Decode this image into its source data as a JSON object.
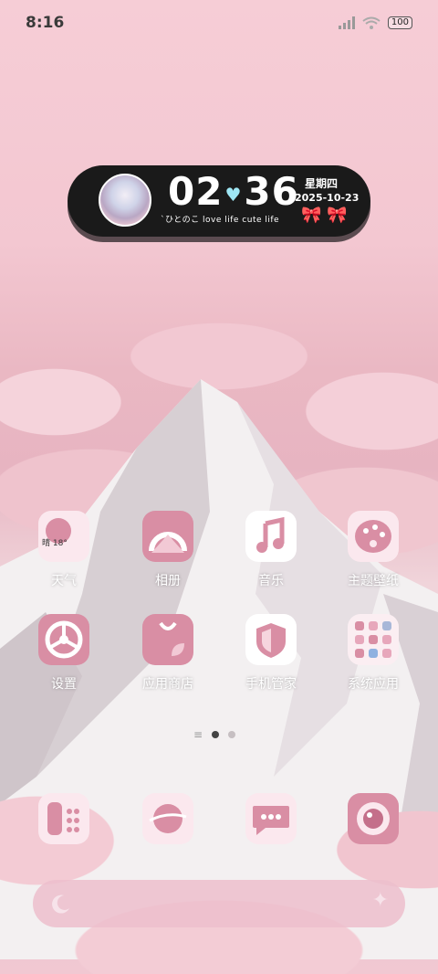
{
  "status": {
    "time": "8:16",
    "battery": "100"
  },
  "widget": {
    "hours": "02",
    "minutes": "36",
    "weekday": "星期四",
    "date": "2025-10-23",
    "tagline": "`ひとのこ love life cute life"
  },
  "apps": [
    {
      "name": "weather",
      "label": "天气",
      "sub": "晴 18°"
    },
    {
      "name": "gallery",
      "label": "相册"
    },
    {
      "name": "music",
      "label": "音乐"
    },
    {
      "name": "themes",
      "label": "主题壁纸"
    },
    {
      "name": "settings",
      "label": "设置"
    },
    {
      "name": "app-store",
      "label": "应用商店"
    },
    {
      "name": "security",
      "label": "手机管家"
    },
    {
      "name": "system-apps",
      "label": "系统应用"
    }
  ],
  "dock": [
    "phone",
    "browser",
    "messages",
    "camera"
  ],
  "colors": {
    "accent": "#d98ea4",
    "background": "#f3c7d1"
  }
}
